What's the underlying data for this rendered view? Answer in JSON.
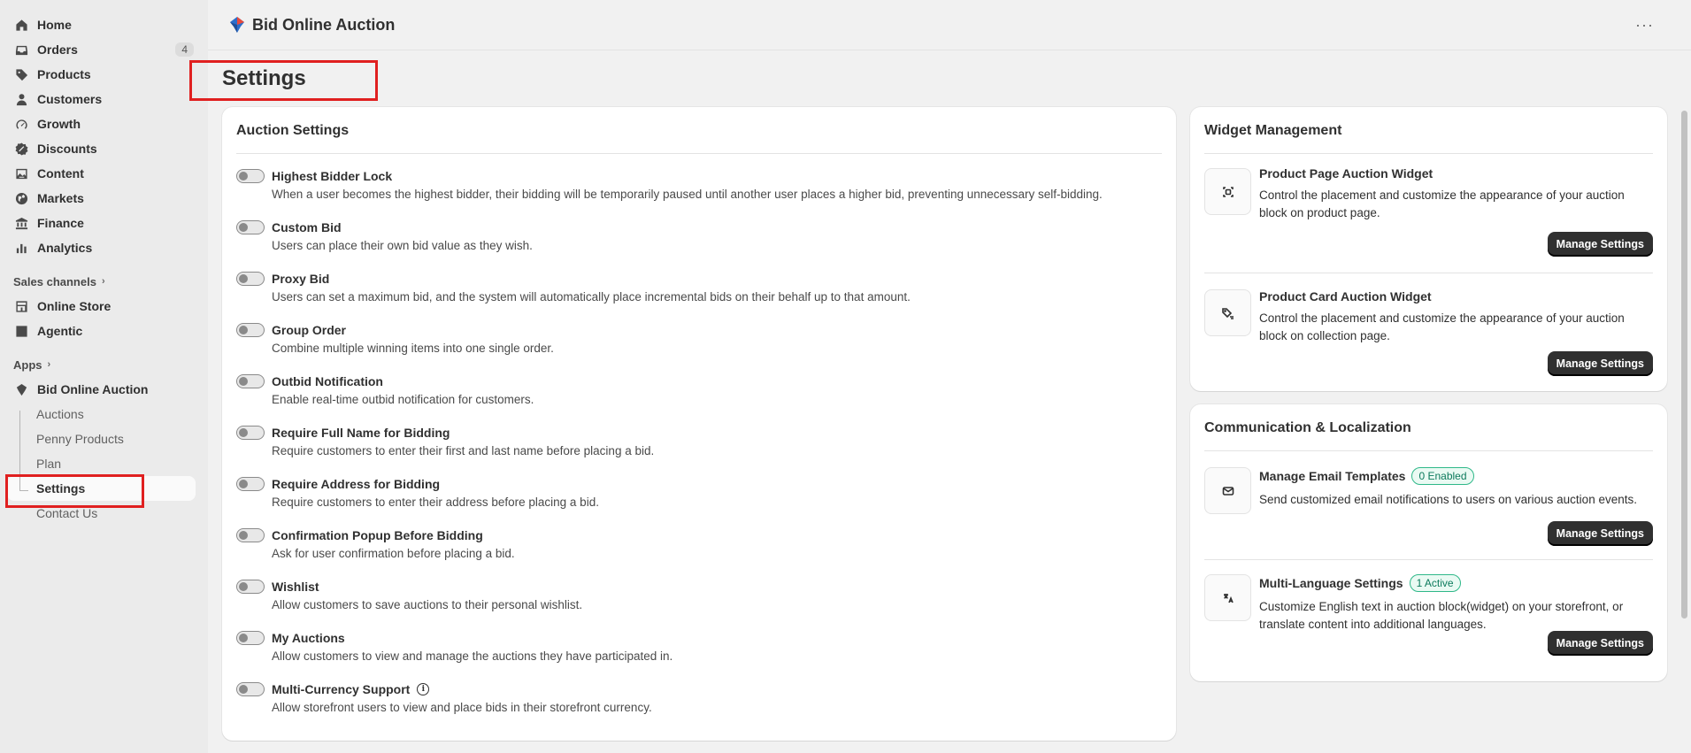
{
  "sidebar": {
    "nav": [
      {
        "label": "Home",
        "icon": "home-icon"
      },
      {
        "label": "Orders",
        "icon": "inbox-icon",
        "badge": "4"
      },
      {
        "label": "Products",
        "icon": "tag-icon"
      },
      {
        "label": "Customers",
        "icon": "person-icon"
      },
      {
        "label": "Growth",
        "icon": "gauge-icon"
      },
      {
        "label": "Discounts",
        "icon": "discount-icon"
      },
      {
        "label": "Content",
        "icon": "image-icon"
      },
      {
        "label": "Markets",
        "icon": "globe-icon"
      },
      {
        "label": "Finance",
        "icon": "bank-icon"
      },
      {
        "label": "Analytics",
        "icon": "bar-chart-icon"
      }
    ],
    "sales_channels_label": "Sales channels",
    "channels": [
      {
        "label": "Online Store",
        "icon": "store-icon"
      },
      {
        "label": "Agentic",
        "icon": "agent-icon"
      }
    ],
    "apps_label": "Apps",
    "app": {
      "label": "Bid Online Auction"
    },
    "app_sub": [
      "Auctions",
      "Penny Products",
      "Plan",
      "Settings",
      "Contact Us"
    ]
  },
  "topbar": {
    "title": "Bid Online Auction",
    "more": "···"
  },
  "page_title": "Settings",
  "auction": {
    "title": "Auction Settings",
    "settings": [
      {
        "name": "Highest Bidder Lock",
        "desc": "When a user becomes the highest bidder, their bidding will be temporarily paused until another user places a higher bid, preventing unnecessary self-bidding."
      },
      {
        "name": "Custom Bid",
        "desc": "Users can place their own bid value as they wish."
      },
      {
        "name": "Proxy Bid",
        "desc": "Users can set a maximum bid, and the system will automatically place incremental bids on their behalf up to that amount."
      },
      {
        "name": "Group Order",
        "desc": "Combine multiple winning items into one single order."
      },
      {
        "name": "Outbid Notification",
        "desc": "Enable real-time outbid notification for customers."
      },
      {
        "name": "Require Full Name for Bidding",
        "desc": "Require customers to enter their first and last name before placing a bid."
      },
      {
        "name": "Require Address for Bidding",
        "desc": "Require customers to enter their address before placing a bid."
      },
      {
        "name": "Confirmation Popup Before Bidding",
        "desc": "Ask for user confirmation before placing a bid."
      },
      {
        "name": "Wishlist",
        "desc": "Allow customers to save auctions to their personal wishlist."
      },
      {
        "name": "My Auctions",
        "desc": "Allow customers to view and manage the auctions they have participated in."
      },
      {
        "name": "Multi-Currency Support",
        "desc": "Allow storefront users to view and place bids in their storefront currency.",
        "info": "i"
      }
    ]
  },
  "widget": {
    "title": "Widget Management",
    "rows": [
      {
        "name": "Product Page Auction Widget",
        "desc": "Control the placement and customize the appearance of your auction block on product page.",
        "button": "Manage Settings"
      },
      {
        "name": "Product Card Auction Widget",
        "desc": "Control the placement and customize the appearance of your auction block on collection page.",
        "button": "Manage Settings"
      }
    ]
  },
  "comm": {
    "title": "Communication & Localization",
    "rows": [
      {
        "name": "Manage Email Templates",
        "badge": "0 Enabled",
        "desc": "Send customized email notifications to users on various auction events.",
        "button": "Manage Settings"
      },
      {
        "name": "Multi-Language Settings",
        "badge": "1 Active",
        "desc": "Customize English text in auction block(widget) on your storefront, or translate content into additional languages.",
        "button": "Manage Settings"
      }
    ]
  },
  "colors": {
    "accent_dark": "#303030",
    "badge_green": "#2fb889",
    "highlight_red": "#e02020"
  }
}
